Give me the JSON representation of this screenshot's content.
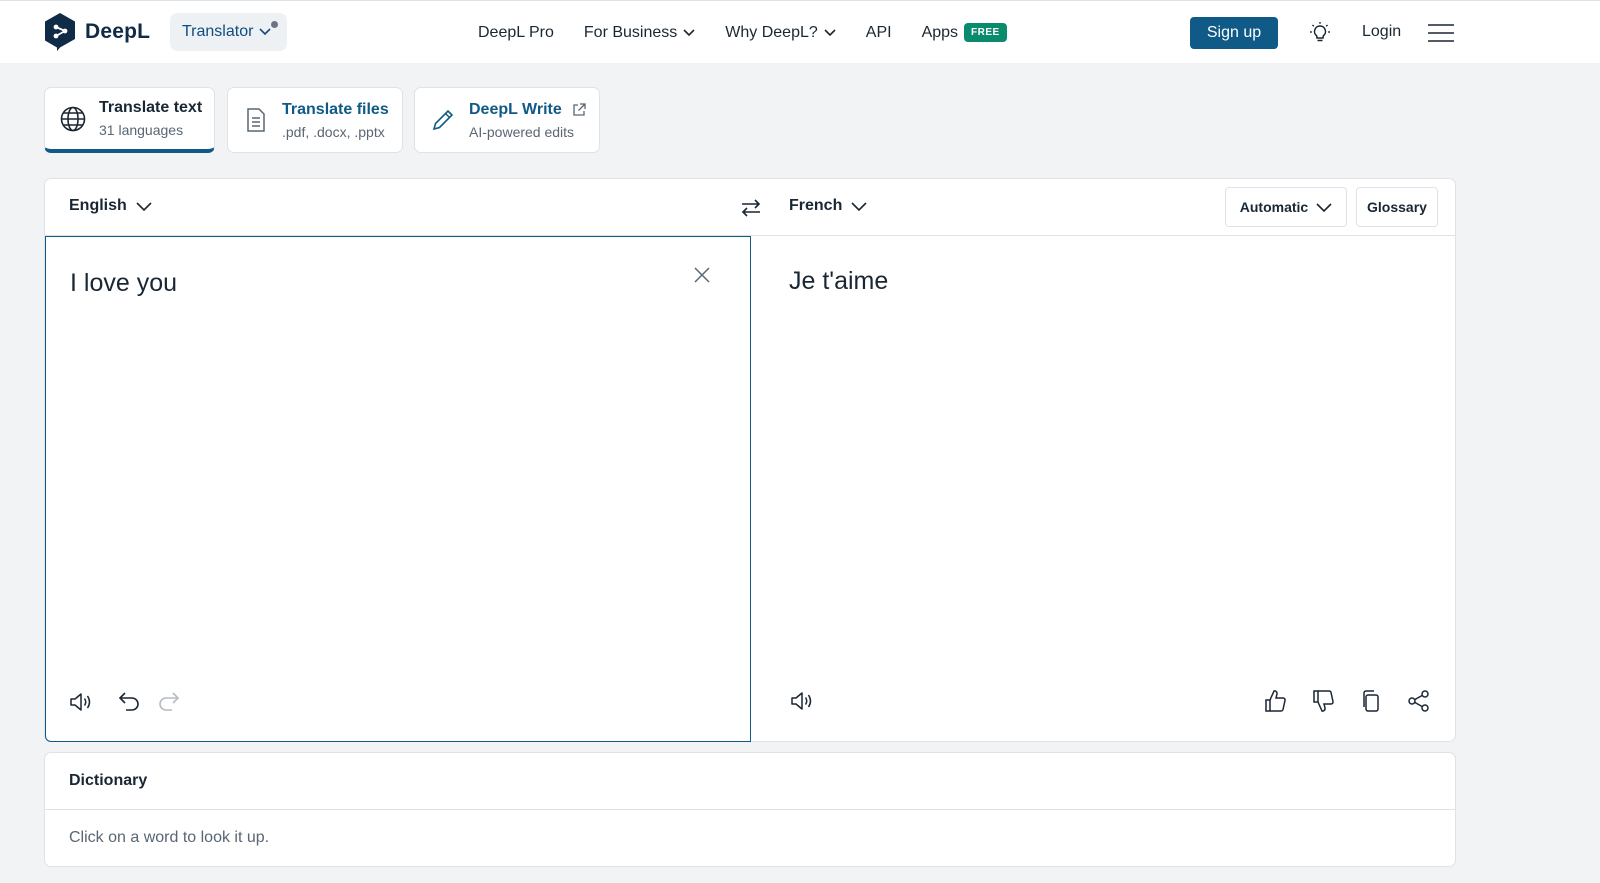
{
  "header": {
    "logo_text": "DeepL",
    "product_switcher": "Translator",
    "nav": [
      "DeepL Pro",
      "For Business",
      "Why DeepL?",
      "API",
      "Apps"
    ],
    "apps_badge": "FREE",
    "signup_label": "Sign up",
    "login_label": "Login"
  },
  "modes": [
    {
      "title": "Translate text",
      "subtitle": "31 languages"
    },
    {
      "title": "Translate files",
      "subtitle": ".pdf, .docx, .pptx"
    },
    {
      "title": "DeepL Write",
      "subtitle": "AI-powered edits"
    }
  ],
  "translator": {
    "source_lang": "English",
    "target_lang": "French",
    "formality": "Automatic",
    "glossary_label": "Glossary",
    "source_text": "I love you",
    "target_text": "Je t'aime"
  },
  "dictionary": {
    "title": "Dictionary",
    "hint": "Click on a word to look it up."
  },
  "colors": {
    "brand_dark": "#0f2b46",
    "accent_blue": "#0f5a86",
    "free_badge": "#0b8b6e"
  }
}
